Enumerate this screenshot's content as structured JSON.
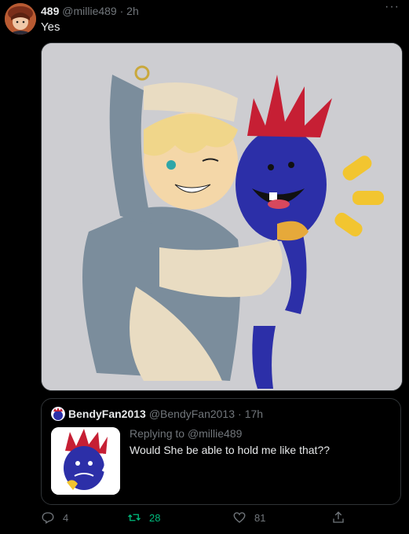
{
  "tweet": {
    "display_name": "489",
    "handle": "@millie489",
    "separator": "·",
    "time": "2h",
    "text": "Yes",
    "more_icon": "more-horizontal-icon"
  },
  "media": {
    "description_icon": "illustration-image"
  },
  "quote": {
    "display_name": "BendyFan2013",
    "handle": "@BendyFan2013",
    "separator": "·",
    "time": "17h",
    "replying_prefix": "Replying to",
    "replying_to": "@millie489",
    "text": "Would She be able to hold me like that??"
  },
  "actions": {
    "reply_count": "4",
    "retweet_count": "28",
    "like_count": "81"
  },
  "colors": {
    "background": "#000000",
    "text_primary": "#e7e9ea",
    "text_secondary": "#71767b",
    "retweet_green": "#00ba7c",
    "border": "#2f3336"
  }
}
